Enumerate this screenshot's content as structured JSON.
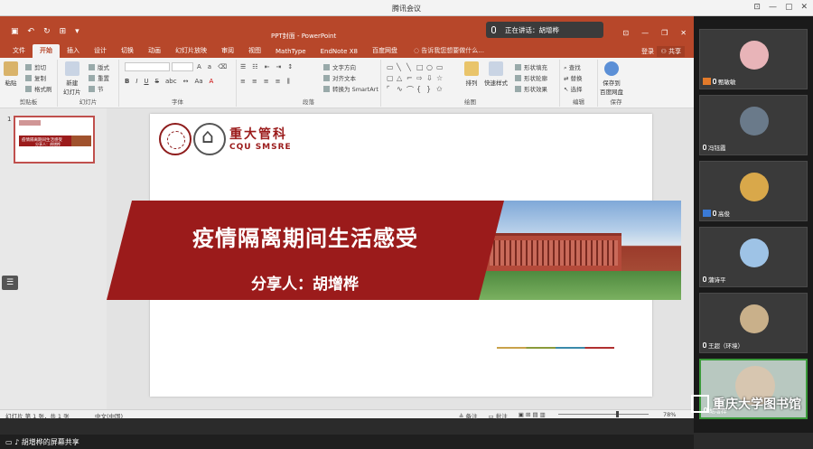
{
  "app": {
    "title": "腾讯会议"
  },
  "speaking": {
    "text": "正在讲话：胡增桦"
  },
  "ppt": {
    "doc_title": "PPT封面 - PowerPoint",
    "tabs": [
      "文件",
      "开始",
      "插入",
      "设计",
      "切换",
      "动画",
      "幻灯片放映",
      "审阅",
      "视图",
      "MathType",
      "EndNote X8",
      "百度网盘"
    ],
    "active_tab": "开始",
    "tell_me": "告诉我您想要做什么...",
    "login": "登录",
    "share": "共享",
    "groups": {
      "clipboard": {
        "label": "剪贴板",
        "paste": "粘贴",
        "cut": "剪切",
        "copy": "复制",
        "format_painter": "格式刷"
      },
      "slides": {
        "label": "幻灯片",
        "new_slide": "新建\n幻灯片",
        "layout": "版式",
        "reset": "重置",
        "section": "节"
      },
      "font": {
        "label": "字体",
        "bold": "B",
        "italic": "I",
        "underline": "U",
        "strike": "S",
        "shadow": "abc"
      },
      "paragraph": {
        "label": "段落",
        "text_direction": "文字方向",
        "align_text": "对齐文本",
        "smartart": "转换为 SmartArt"
      },
      "drawing": {
        "label": "绘图",
        "arrange": "排列",
        "quick_styles": "快速样式",
        "shape_fill": "形状填充",
        "shape_outline": "形状轮廓",
        "shape_effects": "形状效果"
      },
      "editing": {
        "label": "编辑",
        "find": "查找",
        "replace": "替换",
        "select": "选择"
      },
      "save": {
        "label": "保存",
        "save_to": "保存到\n百度网盘"
      }
    },
    "thumb_number": "1",
    "thumb": {
      "title": "疫情隔离期间生活感受",
      "sub": "分享人：胡增桦"
    },
    "slide": {
      "logo_cn": "重大管科",
      "logo_en": "CQU SMSRE",
      "title": "疫情隔离期间生活感受",
      "subtitle": "分享人：胡增桦"
    },
    "status": {
      "slide_info": "幻灯片 第 1 张，共 1 张",
      "language": "中文(中国)",
      "notes": "备注",
      "comments": "批注",
      "zoom": "78%"
    }
  },
  "share_bar": {
    "text": "胡增桦的屏幕共享"
  },
  "participants": [
    {
      "name": "甄敏敏",
      "color": "#e8b4b8"
    },
    {
      "name": "冯钰霞",
      "color": "#6a7a8a"
    },
    {
      "name": "高俊",
      "color": "#d9a84a"
    },
    {
      "name": "蒲诗平",
      "color": "#9ec3e6"
    },
    {
      "name": "王超（环境）",
      "color": "#c9b08a"
    },
    {
      "name": "胡增桦",
      "color": "#d7c6b0"
    }
  ],
  "watermark": {
    "text": "重庆大学图书馆"
  }
}
